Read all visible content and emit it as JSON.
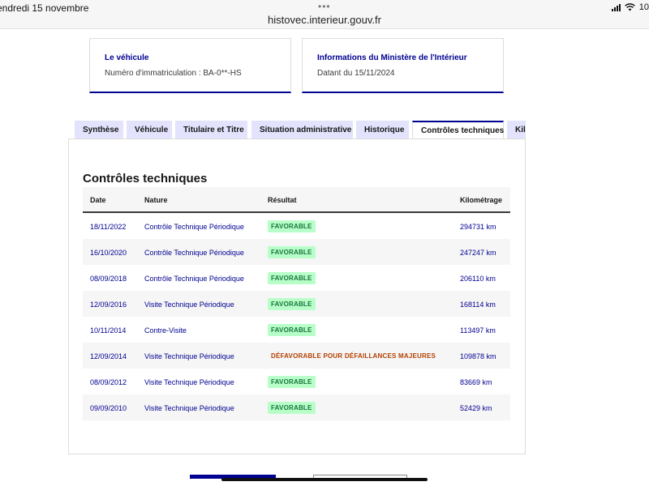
{
  "statusbar": {
    "date": "endredi 15 novembre",
    "url": "histovec.interieur.gouv.fr",
    "battery": "10"
  },
  "cards": {
    "vehicle": {
      "title": "Le véhicule",
      "text": "Numéro d'immatriculation : BA-0**-HS"
    },
    "ministry": {
      "title": "Informations du Ministère de l'Intérieur",
      "text": "Datant du 15/11/2024"
    }
  },
  "tabs": [
    {
      "label": "Synthèse"
    },
    {
      "label": "Véhicule"
    },
    {
      "label": "Titulaire et Titre"
    },
    {
      "label": "Situation administrative"
    },
    {
      "label": "Historique"
    },
    {
      "label": "Contrôles techniques"
    },
    {
      "label": "Kilo"
    }
  ],
  "controles": {
    "title": "Contrôles techniques",
    "columns": {
      "date": "Date",
      "nature": "Nature",
      "result": "Résultat",
      "km": "Kilométrage"
    },
    "rows": [
      {
        "date": "18/11/2022",
        "nature": "Contrôle Technique Périodique",
        "result": "FAVORABLE",
        "km": "294731 km"
      },
      {
        "date": "16/10/2020",
        "nature": "Contrôle Technique Périodique",
        "result": "FAVORABLE",
        "km": "247247 km"
      },
      {
        "date": "08/09/2018",
        "nature": "Contrôle Technique Périodique",
        "result": "FAVORABLE",
        "km": "206110 km"
      },
      {
        "date": "12/09/2016",
        "nature": "Visite Technique Périodique",
        "result": "FAVORABLE",
        "km": "168114 km"
      },
      {
        "date": "10/11/2014",
        "nature": "Contre-Visite",
        "result": "FAVORABLE",
        "km": "113497 km"
      },
      {
        "date": "12/09/2014",
        "nature": "Visite Technique Périodique",
        "result": "DÉFAVORABLE POUR DÉFAILLANCES MAJEURES",
        "km": "109878 km"
      },
      {
        "date": "08/09/2012",
        "nature": "Visite Technique Périodique",
        "result": "FAVORABLE",
        "km": "83669 km"
      },
      {
        "date": "09/09/2010",
        "nature": "Visite Technique Périodique",
        "result": "FAVORABLE",
        "km": "52429 km"
      }
    ]
  },
  "colors": {
    "accent": "#000091",
    "favorable_bg": "#b8fec9",
    "favorable_text": "#18753c",
    "defavorable_text": "#b34000",
    "tab_bg": "#e3e3fd"
  }
}
